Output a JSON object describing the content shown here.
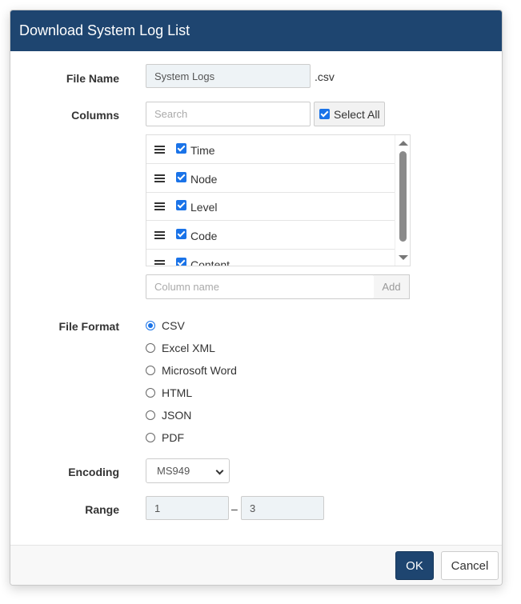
{
  "dialog": {
    "title": "Download System Log List"
  },
  "file_name": {
    "label": "File Name",
    "value": "System Logs",
    "extension": ".csv"
  },
  "columns": {
    "label": "Columns",
    "search_placeholder": "Search",
    "select_all_label": "Select All",
    "items": [
      {
        "label": "Time",
        "checked": true
      },
      {
        "label": "Node",
        "checked": true
      },
      {
        "label": "Level",
        "checked": true
      },
      {
        "label": "Code",
        "checked": true
      },
      {
        "label": "Content",
        "checked": true
      }
    ],
    "new_column_placeholder": "Column name",
    "add_label": "Add"
  },
  "file_format": {
    "label": "File Format",
    "selected": "CSV",
    "options": [
      "CSV",
      "Excel XML",
      "Microsoft Word",
      "HTML",
      "JSON",
      "PDF"
    ]
  },
  "encoding": {
    "label": "Encoding",
    "value": "MS949"
  },
  "range": {
    "label": "Range",
    "from": "1",
    "separator": "–",
    "to": "3"
  },
  "footer": {
    "ok_label": "OK",
    "cancel_label": "Cancel"
  },
  "colors": {
    "header_bg": "#1e4570",
    "accent": "#1a73e8"
  }
}
